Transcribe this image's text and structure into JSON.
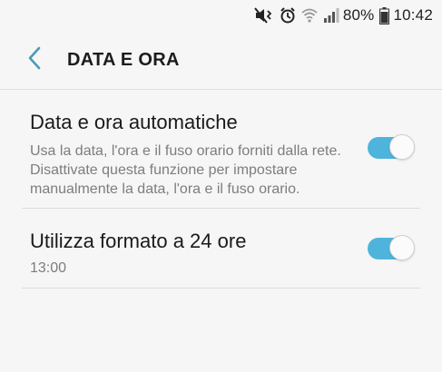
{
  "status_bar": {
    "battery_percent": "80%",
    "time": "10:42",
    "icons": [
      "mute-vibrate-icon",
      "alarm-icon",
      "wifi-icon",
      "signal-icon",
      "battery-icon"
    ]
  },
  "header": {
    "title": "DATA E ORA",
    "back_icon": "chevron-left-icon"
  },
  "settings": [
    {
      "title": "Data e ora automatiche",
      "description": "Usa la data, l'ora e il fuso orario forniti dalla rete. Disattivate questa funzione per impostare manualmente la data, l'ora e il fuso orario.",
      "enabled": true
    },
    {
      "title": "Utilizza formato a 24 ore",
      "description": "13:00",
      "enabled": true
    }
  ],
  "colors": {
    "accent": "#4fb4db",
    "background": "#f6f6f6"
  }
}
